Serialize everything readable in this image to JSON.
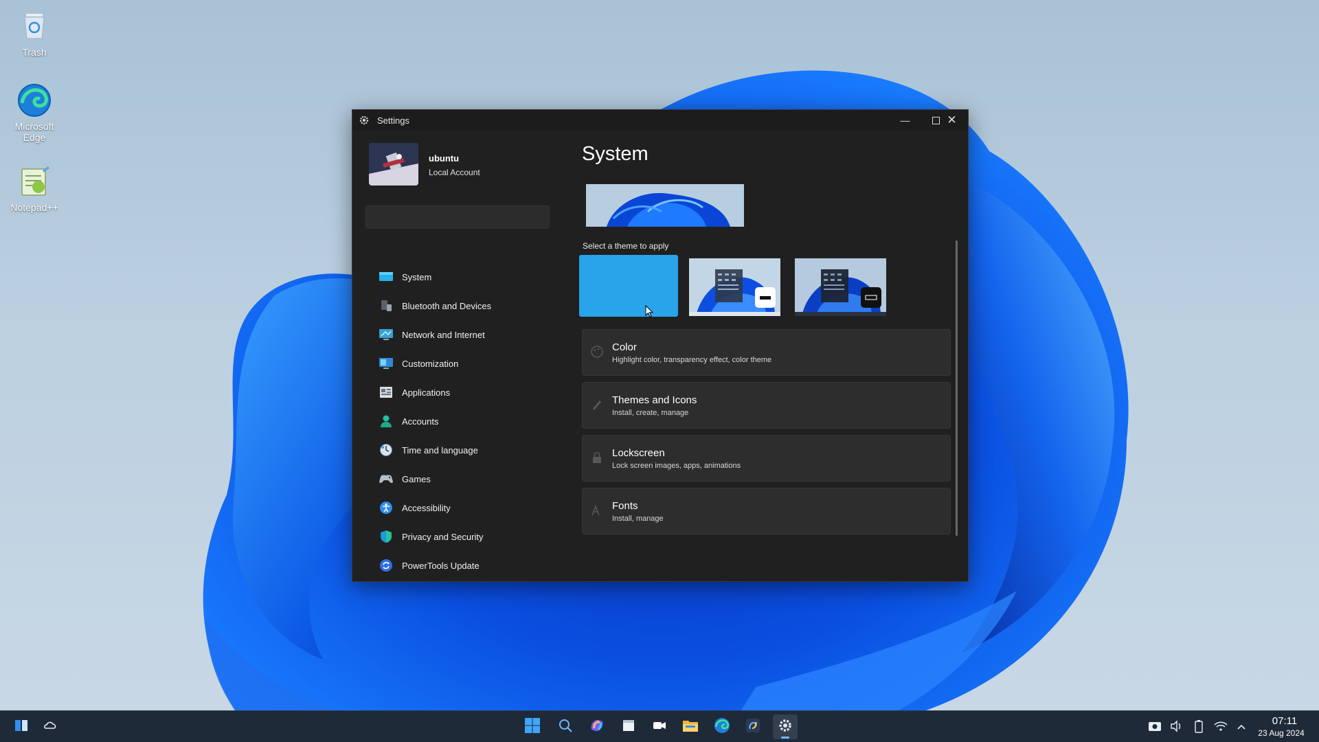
{
  "desktop": {
    "icons": [
      {
        "label": "Trash",
        "icon": "trash-icon"
      },
      {
        "label": "Microsoft Edge",
        "icon": "edge-icon"
      },
      {
        "label": "Notepad++",
        "icon": "notepadpp-icon"
      }
    ]
  },
  "window": {
    "title": "Settings",
    "controls": [
      "minimize",
      "maximize",
      "close"
    ]
  },
  "account": {
    "name": "ubuntu",
    "type": "Local Account"
  },
  "search": {
    "placeholder": ""
  },
  "nav": {
    "items": [
      {
        "label": "System",
        "icon": "display-icon",
        "selected": true
      },
      {
        "label": "Bluetooth and Devices",
        "icon": "devices-icon"
      },
      {
        "label": "Network and Internet",
        "icon": "network-icon"
      },
      {
        "label": "Customization",
        "icon": "personalize-icon"
      },
      {
        "label": "Applications",
        "icon": "apps-icon"
      },
      {
        "label": "Accounts",
        "icon": "user-icon"
      },
      {
        "label": "Time and language",
        "icon": "globe-clock-icon"
      },
      {
        "label": "Games",
        "icon": "gamepad-icon"
      },
      {
        "label": "Accessibility",
        "icon": "accessibility-icon"
      },
      {
        "label": "Privacy and Security",
        "icon": "shield-icon"
      },
      {
        "label": "PowerTools Update",
        "icon": "refresh-icon"
      }
    ]
  },
  "main": {
    "title": "System",
    "theme_label": "Select a theme to apply",
    "themes": [
      {
        "name": "theme-solid-blue",
        "selected": true
      },
      {
        "name": "theme-light"
      },
      {
        "name": "theme-dark"
      }
    ],
    "cards": [
      {
        "title": "Color",
        "subtitle": "Highlight color, transparency effect, color theme",
        "icon": "palette-icon"
      },
      {
        "title": "Themes and Icons",
        "subtitle": "Install, create, manage",
        "icon": "brush-icon"
      },
      {
        "title": "Lockscreen",
        "subtitle": "Lock screen images, apps, animations",
        "icon": "lock-icon"
      },
      {
        "title": "Fonts",
        "subtitle": "Install, manage",
        "icon": "font-icon"
      }
    ]
  },
  "taskbar": {
    "pinned": [
      "start-icon",
      "search-icon",
      "copilot-icon",
      "notes-icon",
      "zoom-icon",
      "file-explorer-icon",
      "edge-icon",
      "python-icon",
      "settings-icon"
    ],
    "active": "settings-icon",
    "tray": [
      "camera-icon",
      "volume-icon",
      "battery-icon",
      "wifi-icon",
      "chevron-up-icon"
    ],
    "time": "07:11",
    "date": "23 Aug 2024"
  },
  "colors": {
    "accent": "#0078d4",
    "window_bg": "#202020",
    "card_bg": "#2d2d2d",
    "taskbar_bg": "#1f2a38",
    "selected_theme": "#29a3ea"
  }
}
